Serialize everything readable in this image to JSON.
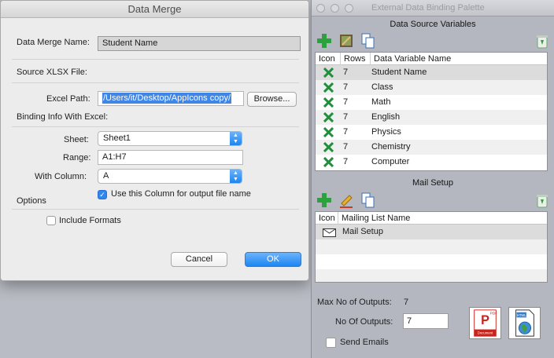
{
  "dialog": {
    "title": "Data Merge",
    "merge_name_label": "Data Merge Name:",
    "merge_name_value": "Student Name",
    "source_label": "Source XLSX File:",
    "excel_path_label": "Excel Path:",
    "excel_path_value": "/Users/it/Desktop/AppIcons copy/",
    "browse_label": "Browse...",
    "binding_label": "Binding Info With Excel:",
    "sheet_label": "Sheet:",
    "sheet_value": "Sheet1",
    "range_label": "Range:",
    "range_value": "A1:H7",
    "column_label": "With Column:",
    "column_value": "A",
    "use_column_label": "Use this Column for output file name",
    "use_column_checked": true,
    "options_label": "Options",
    "include_formats_label": "Include Formats",
    "include_formats_checked": false,
    "cancel_label": "Cancel",
    "ok_label": "OK"
  },
  "palette": {
    "title": "External Data Binding Palette",
    "data_source_title": "Data Source Variables",
    "columns": {
      "icon": "Icon",
      "rows": "Rows",
      "name": "Data Variable Name"
    },
    "variables": [
      {
        "icon": "excel-icon",
        "rows": "7",
        "name": "Student Name"
      },
      {
        "icon": "excel-icon",
        "rows": "7",
        "name": "Class"
      },
      {
        "icon": "excel-icon",
        "rows": "7",
        "name": "Math"
      },
      {
        "icon": "excel-icon",
        "rows": "7",
        "name": "English"
      },
      {
        "icon": "excel-icon",
        "rows": "7",
        "name": "Physics"
      },
      {
        "icon": "excel-icon",
        "rows": "7",
        "name": "Chemistry"
      },
      {
        "icon": "excel-icon",
        "rows": "7",
        "name": "Computer"
      }
    ],
    "mail_setup_title": "Mail Setup",
    "mail_columns": {
      "icon": "Icon",
      "name": "Mailing List Name"
    },
    "mail_items": [
      {
        "icon": "envelope-icon",
        "name": "Mail Setup"
      }
    ],
    "max_outputs_label": "Max No of Outputs:",
    "max_outputs_value": "7",
    "no_outputs_label": "No Of Outputs:",
    "no_outputs_value": "7",
    "send_emails_label": "Send Emails",
    "send_emails_checked": false,
    "pdf_icon_text": "PDF",
    "pdf_icon_caption": "Document",
    "html_icon_text": "HTML",
    "colors": {
      "accent": "#1c86f2",
      "excel_green": "#1f8f3a",
      "pdf_red": "#c6241d"
    }
  }
}
